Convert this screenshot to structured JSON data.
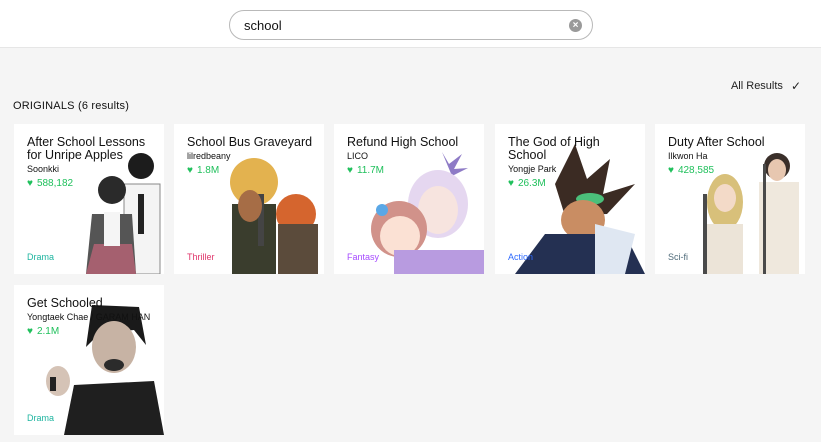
{
  "search": {
    "value": "school",
    "clear_icon": "close-circle-icon"
  },
  "filter": {
    "label": "All Results",
    "icon": "check-icon"
  },
  "section": {
    "title": "ORIGINALS (6 results)"
  },
  "colors": {
    "likes": "#20c05c",
    "drama": "#1fb5a0",
    "thriller": "#e0356b",
    "fantasy": "#a64bff",
    "action": "#2f6bff",
    "scifi": "#4f6b7a"
  },
  "cards": [
    {
      "title": "After School Lessons for Unripe Apples",
      "author": "Soonkki",
      "likes": "588,182",
      "genre": "Drama",
      "genre_color": "#1fb5a0"
    },
    {
      "title": "School Bus Graveyard",
      "author": "lilredbeany",
      "likes": "1.8M",
      "genre": "Thriller",
      "genre_color": "#e0356b"
    },
    {
      "title": "Refund High School",
      "author": "LICO",
      "likes": "11.7M",
      "genre": "Fantasy",
      "genre_color": "#a64bff"
    },
    {
      "title": "The God of High School",
      "author": "Yongje Park",
      "likes": "26.3M",
      "genre": "Action",
      "genre_color": "#2f6bff"
    },
    {
      "title": "Duty After School",
      "author": "Ilkwon Ha",
      "likes": "428,585",
      "genre": "Sci-fi",
      "genre_color": "#4f6b7a"
    },
    {
      "title": "Get Schooled",
      "author": "Yongtaek Chae / GARAM HAN",
      "likes": "2.1M",
      "genre": "Drama",
      "genre_color": "#1fb5a0"
    }
  ]
}
